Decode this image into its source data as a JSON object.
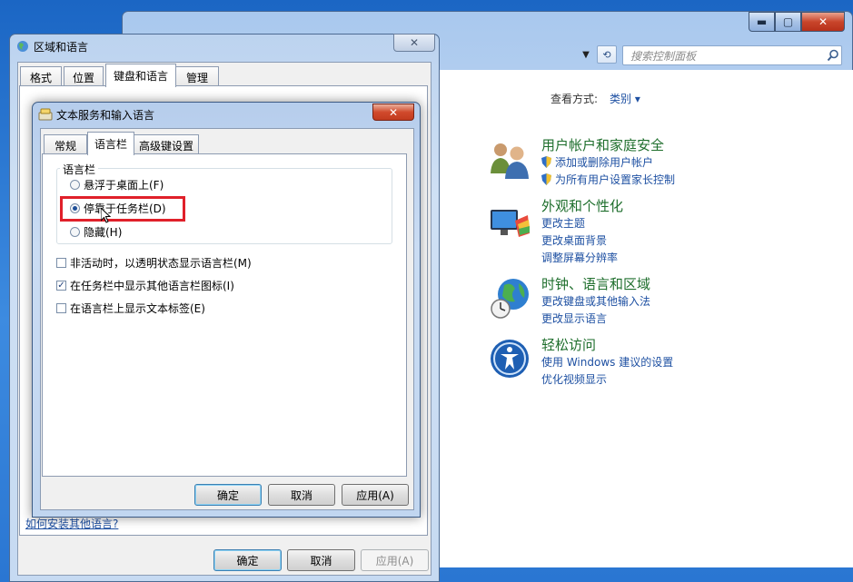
{
  "control_panel": {
    "search_placeholder": "搜索控制面板",
    "view_by_label": "查看方式:",
    "view_by_value": "类别 ▾",
    "categories": [
      {
        "title": "用户帐户和家庭安全",
        "links": [
          "添加或删除用户帐户",
          "为所有用户设置家长控制"
        ],
        "icon": "users-icon"
      },
      {
        "title": "外观和个性化",
        "links": [
          "更改主题",
          "更改桌面背景",
          "调整屏幕分辨率"
        ],
        "icon": "display-icon"
      },
      {
        "title": "时钟、语言和区域",
        "links": [
          "更改键盘或其他输入法",
          "更改显示语言"
        ],
        "icon": "globe-clock-icon"
      },
      {
        "title": "轻松访问",
        "links": [
          "使用 Windows 建议的设置",
          "优化视频显示"
        ],
        "icon": "accessibility-icon"
      }
    ]
  },
  "region_window": {
    "title": "区域和语言",
    "tabs": [
      "格式",
      "位置",
      "键盘和语言",
      "管理"
    ],
    "active_tab": "键盘和语言",
    "link": "如何安装其他语言?",
    "buttons": {
      "ok": "确定",
      "cancel": "取消",
      "apply": "应用(A)"
    }
  },
  "text_services": {
    "title": "文本服务和输入语言",
    "tabs": [
      "常规",
      "语言栏",
      "高级键设置"
    ],
    "active_tab": "语言栏",
    "group_label": "语言栏",
    "radios": [
      {
        "label": "悬浮于桌面上(F)",
        "checked": false
      },
      {
        "label": "停靠于任务栏(D)",
        "checked": true
      },
      {
        "label": "隐藏(H)",
        "checked": false
      }
    ],
    "checkboxes": [
      {
        "label": "非活动时，以透明状态显示语言栏(M)",
        "checked": false
      },
      {
        "label": "在任务栏中显示其他语言栏图标(I)",
        "checked": true
      },
      {
        "label": "在语言栏上显示文本标签(E)",
        "checked": false
      }
    ],
    "buttons": {
      "ok": "确定",
      "cancel": "取消",
      "apply": "应用(A)"
    }
  },
  "colors": {
    "link": "#1e50a2",
    "category_title": "#1e6e2c",
    "highlight": "#e0202a"
  }
}
